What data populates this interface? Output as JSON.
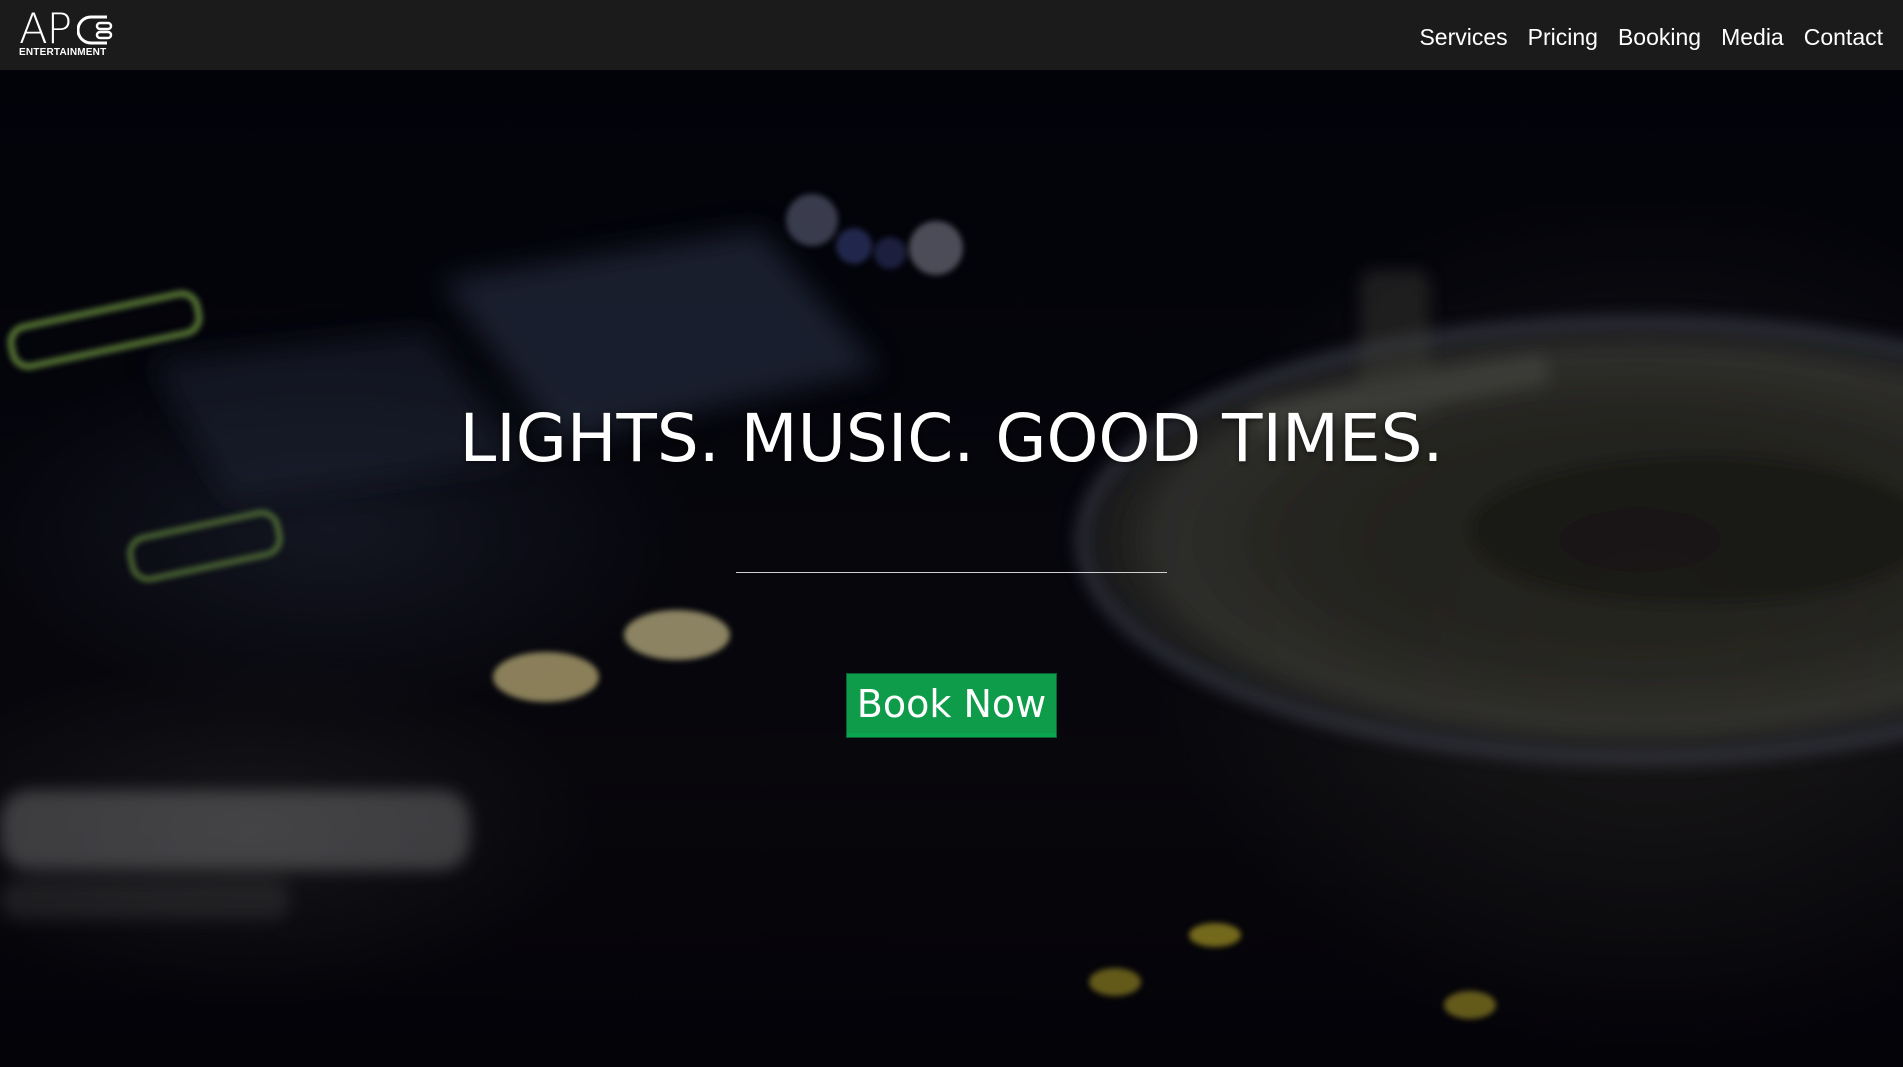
{
  "brand": {
    "logo_mark": "AP",
    "logo_sub": "ENTERTAINMENT",
    "logo_c_icon": "stylized-c-plug-icon"
  },
  "nav": {
    "items": [
      {
        "label": "Services"
      },
      {
        "label": "Pricing"
      },
      {
        "label": "Booking"
      },
      {
        "label": "Media"
      },
      {
        "label": "Contact"
      }
    ]
  },
  "hero": {
    "title": "LIGHTS. MUSIC. GOOD TIMES.",
    "cta_label": "Book Now",
    "background": "dark-dj-mixer-turntable-photo"
  },
  "colors": {
    "navbar_bg": "#1b1b1b",
    "cta_bg": "#0e9b4a",
    "text": "#ffffff"
  }
}
